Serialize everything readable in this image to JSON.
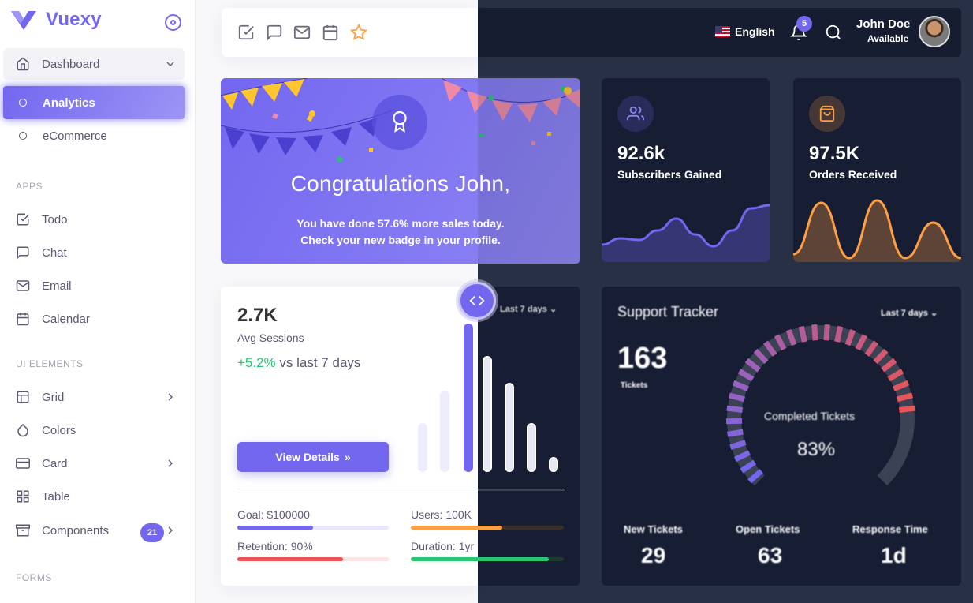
{
  "brand": {
    "name": "Vuexy",
    "accent": "#7367f0"
  },
  "sidebar": {
    "dashboard": "Dashboard",
    "analytics": "Analytics",
    "ecommerce": "eCommerce",
    "section_apps": "APPS",
    "apps": [
      "Todo",
      "Chat",
      "Email",
      "Calendar"
    ],
    "section_ui": "UI ELEMENTS",
    "ui": [
      "Grid",
      "Colors",
      "Card",
      "Table",
      "Components"
    ],
    "components_badge": "21",
    "section_forms": "FORMS"
  },
  "navbar": {
    "bookmarks": [
      "check-square-icon",
      "message-square-icon",
      "mail-icon",
      "calendar-icon",
      "star-icon"
    ],
    "language": "English",
    "notifications": "5",
    "user_name": "John Doe",
    "user_status": "Available"
  },
  "congrats": {
    "title": "Congratulations John,",
    "line1_pre": "You have done ",
    "line1_value": "57.6%",
    "line1_post": " more sales today.",
    "line2": "Check your new badge in your profile."
  },
  "subscribers": {
    "value": "92.6k",
    "label": "Subscribers Gained",
    "trend": [
      22,
      30,
      28,
      40,
      55,
      35,
      20,
      40,
      68,
      72
    ]
  },
  "orders": {
    "value": "97.5K",
    "label": "Orders Received",
    "trend": [
      10,
      75,
      5,
      78,
      5,
      50,
      5
    ]
  },
  "sessions": {
    "value": "2.7K",
    "label": "Avg Sessions",
    "delta": "+5.2%",
    "delta_suffix": " vs last 7 days",
    "button": "View Details",
    "period": "Last 7 days",
    "bars": [
      0.33,
      0.55,
      1.0,
      0.78,
      0.6,
      0.33,
      0.1
    ],
    "goal": "Goal: $100000",
    "goal_fill": 0.5,
    "users": "Users: 100K",
    "users_fill": 0.6,
    "retention": "Retention: 90%",
    "retention_fill": 0.7,
    "duration": "Duration: 1yr",
    "duration_fill": 0.9
  },
  "support": {
    "title": "Support Tracker",
    "period": "Last 7 days",
    "tickets": "163",
    "tickets_label": "Tickets",
    "completed_label": "Completed Tickets",
    "completed": "83%",
    "new_label": "New Tickets",
    "new_value": "29",
    "open_label": "Open Tickets",
    "open_value": "63",
    "response_label": "Response Time",
    "response_value": "1d"
  }
}
